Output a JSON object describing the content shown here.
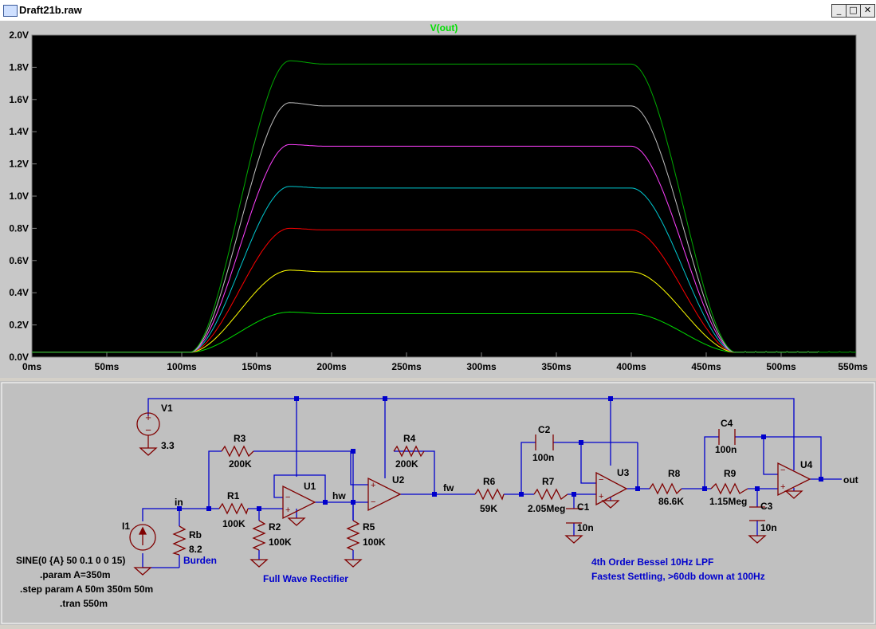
{
  "window": {
    "title": "Draft21b.raw",
    "minimize_icon": "minimize-icon",
    "maximize_icon": "maximize-icon",
    "close_icon": "close-icon"
  },
  "colors": {
    "plot_background": "#000000",
    "axis_text": "#000000",
    "schematic_background": "#c0c0c0",
    "wire": "#0000cc",
    "component": "#800000",
    "trace_title": "#00e000"
  },
  "plot": {
    "trace_title": "V(out)"
  },
  "chart_data": {
    "type": "line",
    "title": "V(out)",
    "xlabel": "",
    "ylabel": "",
    "xlim": [
      0,
      550
    ],
    "ylim": [
      0,
      2.0
    ],
    "x_unit": "ms",
    "grid": false,
    "x_ticks": [
      "0ms",
      "50ms",
      "100ms",
      "150ms",
      "200ms",
      "250ms",
      "300ms",
      "350ms",
      "400ms",
      "450ms",
      "500ms",
      "550ms"
    ],
    "y_ticks": [
      "0.0V",
      "0.2V",
      "0.4V",
      "0.6V",
      "0.8V",
      "1.0V",
      "1.2V",
      "1.4V",
      "1.6V",
      "1.8V",
      "2.0V"
    ],
    "series": [
      {
        "color": "#00dd00",
        "start": 0.03,
        "peak": 0.28,
        "plateau": 0.27,
        "end_time": 525
      },
      {
        "color": "#ffff00",
        "start": 0.03,
        "peak": 0.54,
        "plateau": 0.53,
        "end_time": 525
      },
      {
        "color": "#ff0000",
        "start": 0.03,
        "peak": 0.8,
        "plateau": 0.79,
        "end_time": 525
      },
      {
        "color": "#00c8d0",
        "start": 0.03,
        "peak": 1.06,
        "plateau": 1.05,
        "end_time": 525
      },
      {
        "color": "#ff40ff",
        "start": 0.03,
        "peak": 1.32,
        "plateau": 1.31,
        "end_time": 525
      },
      {
        "color": "#c0c0c0",
        "start": 0.03,
        "peak": 1.58,
        "plateau": 1.56,
        "end_time": 525
      },
      {
        "color": "#00aa00",
        "start": 0.03,
        "peak": 1.84,
        "plateau": 1.82,
        "end_time": 550
      }
    ]
  },
  "schematic": {
    "components": {
      "V1": {
        "name": "V1",
        "value": "3.3"
      },
      "I1": {
        "name": "I1"
      },
      "Rb": {
        "name": "Rb",
        "value": "8.2"
      },
      "R1": {
        "name": "R1",
        "value": "100K"
      },
      "R2": {
        "name": "R2",
        "value": "100K"
      },
      "R3": {
        "name": "R3",
        "value": "200K"
      },
      "R4": {
        "name": "R4",
        "value": "200K"
      },
      "R5": {
        "name": "R5",
        "value": "100K"
      },
      "R6": {
        "name": "R6",
        "value": "59K"
      },
      "R7": {
        "name": "R7",
        "value": "2.05Meg"
      },
      "R8": {
        "name": "R8",
        "value": "86.6K"
      },
      "R9": {
        "name": "R9",
        "value": "1.15Meg"
      },
      "C1": {
        "name": "C1",
        "value": "10n"
      },
      "C2": {
        "name": "C2",
        "value": "100n"
      },
      "C3": {
        "name": "C3",
        "value": "10n"
      },
      "C4": {
        "name": "C4",
        "value": "100n"
      },
      "U1": {
        "name": "U1"
      },
      "U2": {
        "name": "U2"
      },
      "U3": {
        "name": "U3"
      },
      "U4": {
        "name": "U4"
      }
    },
    "nets": {
      "in": "in",
      "hw": "hw",
      "fw": "fw",
      "out": "out"
    },
    "burden_label": "Burden",
    "rectifier_label": "Full Wave Rectifier",
    "filter_label_1": "4th Order Bessel 10Hz LPF",
    "filter_label_2": "Fastest Settling, >60db down at 100Hz",
    "directives": [
      "SINE(0 {A} 50 0.1 0 0 15)",
      ".param A=350m",
      ".step param A 50m 350m 50m",
      ".tran 550m"
    ]
  }
}
